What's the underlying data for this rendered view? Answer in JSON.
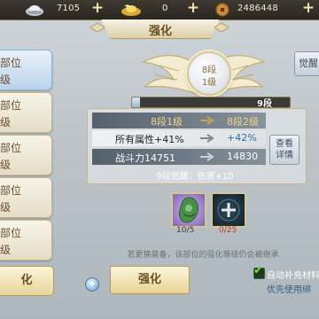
{
  "currency": {
    "silver": "7105",
    "gold": "0",
    "copper": "2486448"
  },
  "title": "强化",
  "parts": [
    {
      "name": "部位",
      "level": "级"
    },
    {
      "name": "部位",
      "level": "级"
    },
    {
      "name": "部位",
      "level": "级"
    },
    {
      "name": "部位",
      "level": "级"
    },
    {
      "name": "部位",
      "level": "级"
    }
  ],
  "left_button": "化",
  "awaken_button": "觉醒",
  "medal": {
    "stage": "8段",
    "level": "1级"
  },
  "progress": {
    "label": "9段",
    "fraction": 0.05
  },
  "stats": {
    "level": {
      "from": "8段1级",
      "to": "8段2级"
    },
    "all_attr": {
      "name": "所有属性+41%",
      "to": "+42%"
    },
    "power": {
      "name": "战斗力14751",
      "to": "14830"
    }
  },
  "detail_button": {
    "line1": "查看",
    "line2": "详情"
  },
  "awake_bonus": "9段觉醒：伤害+10",
  "materials": [
    {
      "count": "10/5"
    },
    {
      "count": "0/25"
    }
  ],
  "hint": "若更换装备，该部位的强化等级仍会被继承",
  "main_button": "强化",
  "auto_fill": {
    "label": "自动补充材料",
    "sub": "优先使用绑"
  },
  "colors": {
    "accent_gold": "#d9c68d",
    "selected_blue": "#bcd3ea",
    "warning_red": "#c0392b"
  }
}
